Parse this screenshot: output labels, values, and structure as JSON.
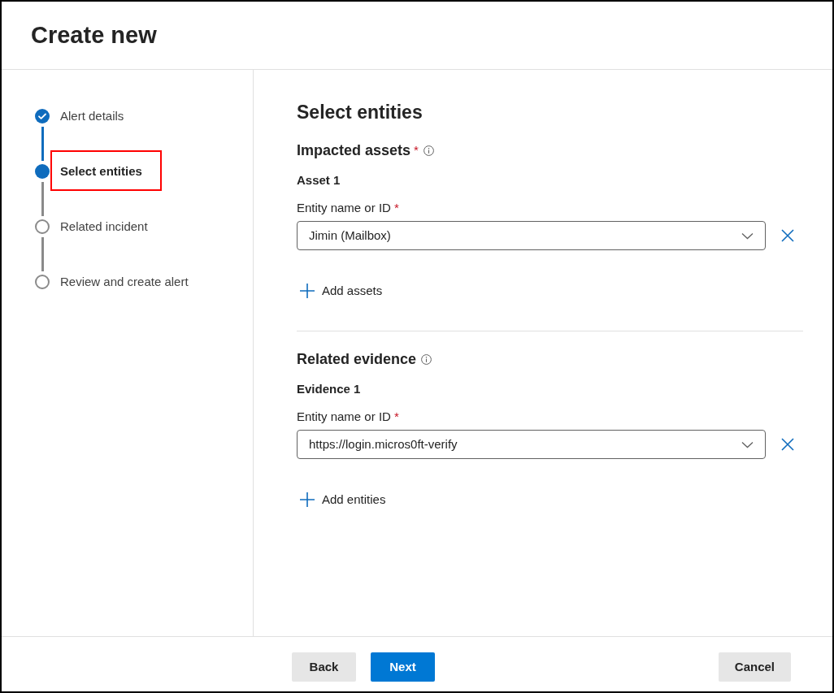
{
  "window": {
    "title": "Create new"
  },
  "steps": [
    {
      "label": "Alert details",
      "completed": true,
      "selected": false,
      "highlighted": false
    },
    {
      "label": "Select entities",
      "completed": false,
      "selected": true,
      "highlighted": true
    },
    {
      "label": "Related incident",
      "completed": false,
      "selected": false,
      "highlighted": false
    },
    {
      "label": "Review and create alert",
      "completed": false,
      "selected": false,
      "highlighted": false
    }
  ],
  "content": {
    "title": "Select entities",
    "sections": [
      {
        "title": "Impacted assets",
        "required_mark": "*",
        "items": [
          {
            "heading": "Asset 1",
            "field": {
              "label": "Entity name or ID",
              "required_mark": "*",
              "value": "Jimin (Mailbox)"
            }
          }
        ],
        "add_button": "Add assets"
      },
      {
        "title": "Related evidence",
        "items": [
          {
            "heading": "Evidence 1",
            "field": {
              "label": "Entity name or ID",
              "required_mark": "*",
              "value": "https://login.micros0ft-verify"
            }
          }
        ],
        "add_button": "Add entities"
      }
    ]
  },
  "footer": {
    "left_buttons": [
      {
        "label": "Back",
        "kind": "secondary"
      },
      {
        "label": "Next",
        "kind": "primary"
      }
    ],
    "right_buttons": [
      {
        "label": "Cancel",
        "kind": "secondary"
      }
    ]
  }
}
